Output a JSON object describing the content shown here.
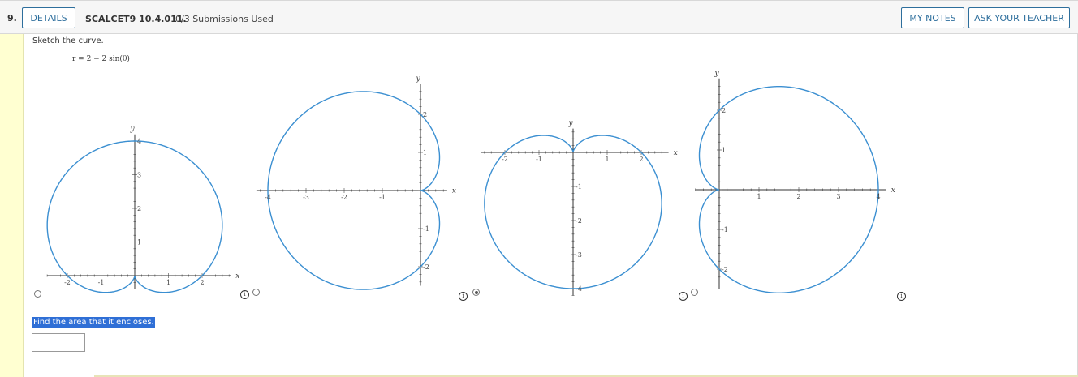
{
  "header": {
    "question_number": "9.",
    "details_label": "DETAILS",
    "question_id": "SCALCET9 10.4.011.",
    "submissions": "0/3 Submissions Used",
    "my_notes_label": "MY NOTES",
    "ask_teacher_label": "ASK YOUR TEACHER"
  },
  "question": {
    "prompt": "Sketch the curve.",
    "equation": "r = 2 − 2 sin(θ)",
    "find_prompt": "Find the area that it encloses.",
    "answer_value": ""
  },
  "options": [
    {
      "id": "A",
      "selected": false
    },
    {
      "id": "B",
      "selected": false
    },
    {
      "id": "C",
      "selected": true
    },
    {
      "id": "D",
      "selected": false
    }
  ],
  "graphs": {
    "axis_x": "x",
    "axis_y": "y",
    "g1": {
      "x_ticks": [
        "-2",
        "-1",
        "1",
        "2"
      ],
      "y_ticks": [
        "1",
        "2",
        "3",
        "4"
      ]
    },
    "g2": {
      "x_ticks": [
        "-4",
        "-3",
        "-2",
        "-1"
      ],
      "y_ticks": [
        "2",
        "1",
        "-1",
        "-2"
      ]
    },
    "g3": {
      "x_ticks": [
        "-2",
        "-1",
        "1",
        "2"
      ],
      "y_ticks": [
        "-1",
        "-2",
        "-3",
        "-4"
      ]
    },
    "g4": {
      "x_ticks": [
        "1",
        "2",
        "3",
        "4"
      ],
      "y_ticks": [
        "2",
        "1",
        "-1",
        "-2"
      ]
    }
  },
  "colors": {
    "curve": "#3b8fd1",
    "link": "#2d6e9c",
    "highlight": "#2f6fd6",
    "sidebar": "#ffffd1"
  }
}
